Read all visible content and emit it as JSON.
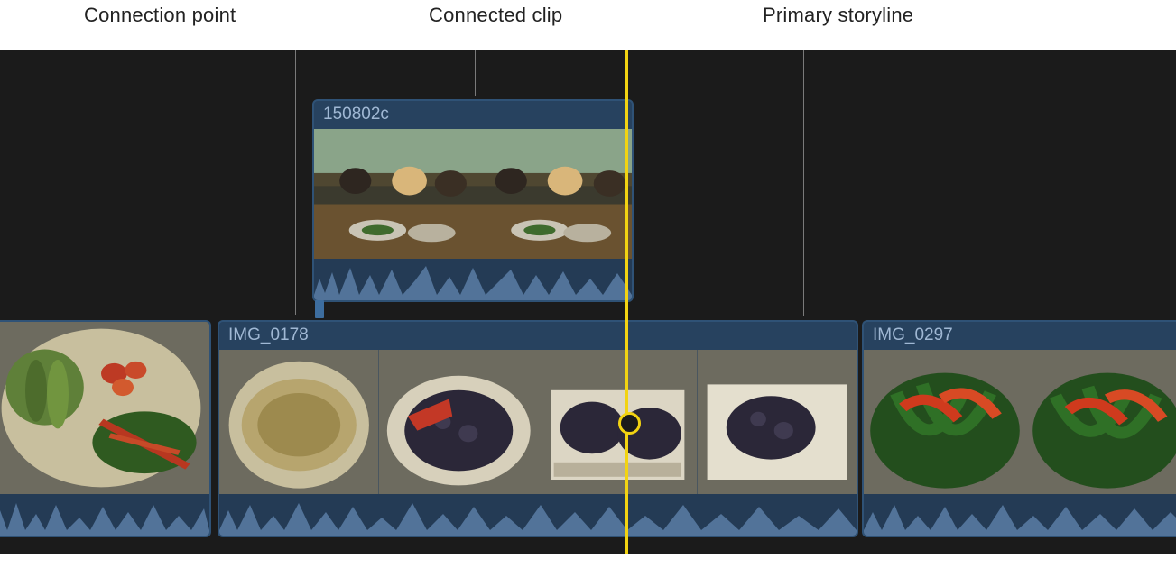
{
  "labels": {
    "connection_point": "Connection point",
    "connected_clip": "Connected clip",
    "primary_storyline": "Primary storyline"
  },
  "connected_clip": {
    "name": "150802c"
  },
  "storyline": {
    "clip_b_name": "IMG_0178",
    "clip_c_name": "IMG_0297"
  },
  "colors": {
    "playhead": "#f2d312",
    "clip_border": "#2f5276",
    "clip_fill": "#27425f",
    "clip_text": "#a0b8d4"
  }
}
